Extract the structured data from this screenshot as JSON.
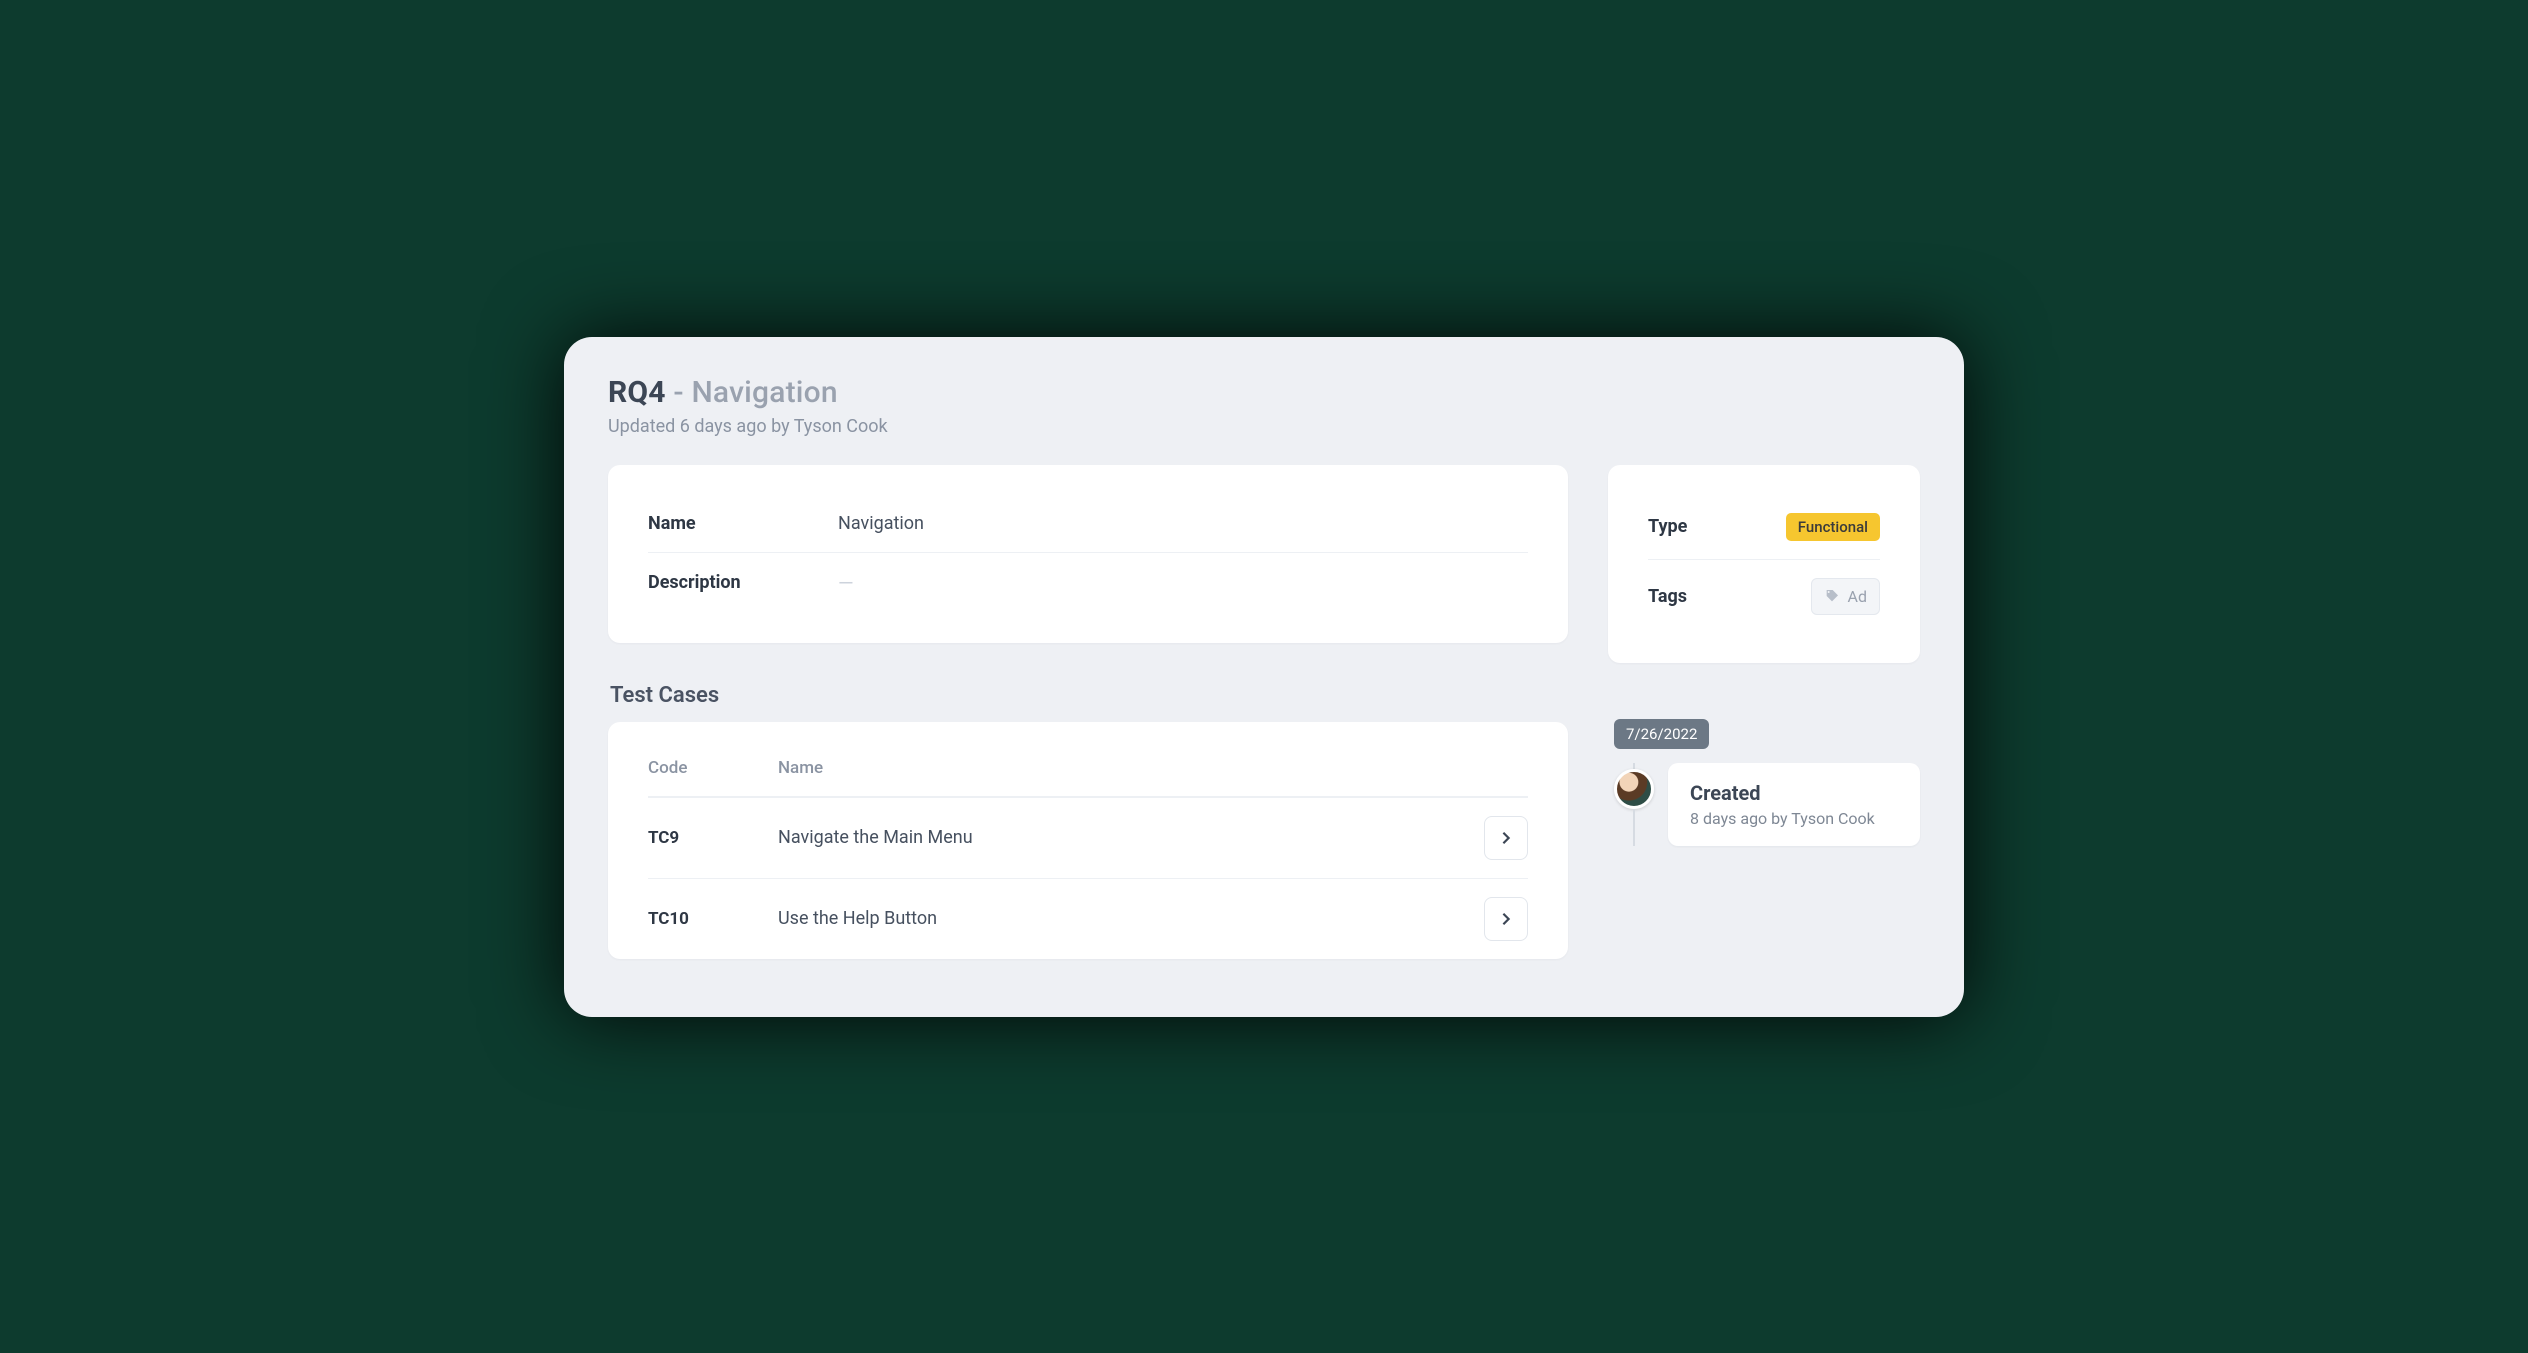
{
  "header": {
    "code": "RQ4",
    "title": "Navigation",
    "subtitle": "Updated 6 days ago by Tyson Cook"
  },
  "details": {
    "name_label": "Name",
    "name_value": "Navigation",
    "description_label": "Description",
    "description_value": "—"
  },
  "meta": {
    "type_label": "Type",
    "type_value": "Functional",
    "tags_label": "Tags",
    "tags_placeholder": "Ad"
  },
  "test_cases": {
    "heading": "Test Cases",
    "columns": {
      "code": "Code",
      "name": "Name"
    },
    "rows": [
      {
        "code": "TC9",
        "name": "Navigate the Main Menu"
      },
      {
        "code": "TC10",
        "name": "Use the Help Button"
      }
    ]
  },
  "timeline": {
    "date": "7/26/2022",
    "event_title": "Created",
    "event_sub": "8 days ago by Tyson Cook"
  }
}
